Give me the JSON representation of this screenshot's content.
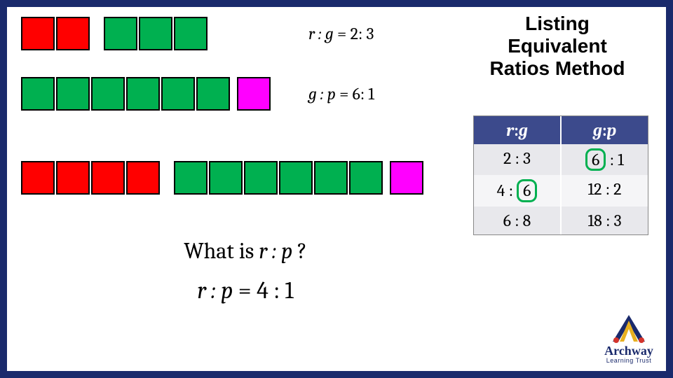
{
  "title": "Listing Equivalent Ratios Method",
  "row1": {
    "red": 2,
    "green": 3,
    "ratio_lhs": "r : g",
    "ratio_rhs": "2: 3"
  },
  "row2": {
    "green": 6,
    "pink": 1,
    "ratio_lhs": "g : p",
    "ratio_rhs": "6: 1"
  },
  "row3": {
    "red": 4,
    "green": 6,
    "pink": 1
  },
  "question_prefix": "What is ",
  "question_expr": "r : p",
  "question_suffix": " ?",
  "answer_lhs": "r : p",
  "answer_rhs": "4 : 1",
  "table": {
    "head": {
      "c1_a": "r",
      "c1_b": "g",
      "c2_a": "g",
      "c2_b": "p",
      "colon": ":"
    },
    "rows": [
      {
        "c1_a": "2",
        "c1_b": "3",
        "c2_a": "6",
        "c2_b": "1",
        "circle_c2a": true
      },
      {
        "c1_a": "4",
        "c1_b": "6",
        "c2_a": "12",
        "c2_b": "2",
        "circle_c1b": true
      },
      {
        "c1_a": "6",
        "c1_b": "8",
        "c2_a": "18",
        "c2_b": "3"
      }
    ]
  },
  "logo": {
    "name": "Archway",
    "sub": "Learning Trust"
  },
  "colors": {
    "red": "#ff0000",
    "green": "#00b050",
    "pink": "#ff00ff",
    "navy": "#1a2a6c"
  }
}
